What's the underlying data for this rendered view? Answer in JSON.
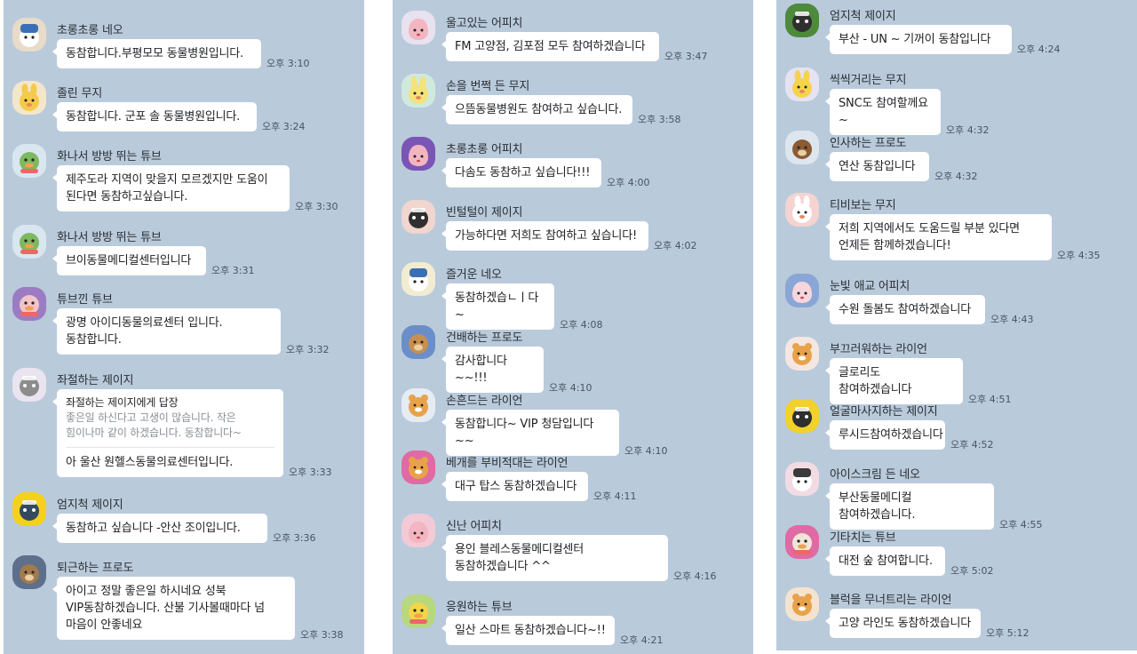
{
  "panels": [
    {
      "messages": [
        {
          "sender": "초롱초롱 네오",
          "text": "동참합니다.부평모모 동물병원입니다.",
          "time": "오후 3:10",
          "avatar": "neo-icon",
          "color": "#e8dbc7",
          "face": "#3b6fb5"
        },
        {
          "sender": "졸린 무지",
          "text": "동참합니다. 군포 솔 동물병원입니다.",
          "time": "오후 3:24",
          "avatar": "muzi-icon",
          "color": "#f3e7c9",
          "face": "#f5c94a"
        },
        {
          "sender": "화나서 방방 뛰는 튜브",
          "text": "제주도라 지역이 맞을지 모르겠지만 도움이 된다면 동참하고싶습니다.",
          "time": "오후 3:30",
          "avatar": "tube-icon",
          "color": "#d9e6ef",
          "face": "#7db95e"
        },
        {
          "sender": "화나서 방방 뛰는 튜브",
          "text": "브이동물메디컬센터입니다",
          "time": "오후 3:31",
          "avatar": "tube-icon",
          "color": "#d9e6ef",
          "face": "#7db95e"
        },
        {
          "sender": "튜브낀 튜브",
          "text": "광명 아이디동물의료센터 입니다. 동참합니다.",
          "time": "오후 3:32",
          "avatar": "tube-icon",
          "color": "#9b7cc2",
          "face": "#f2c3c9"
        },
        {
          "sender": "좌절하는 제이지",
          "reply_to": "좌절하는 제이지에게 답장",
          "quote": "좋은일 하신다고 고생이 많습니다. 작은 힘이나마 같이 하겠습니다. 동참합니다~",
          "text": "아 울산 원헬스동물의료센터입니다.",
          "time": "오후 3:33",
          "avatar": "jayg-icon",
          "color": "#e9e4ef",
          "face": "#8c8c8c"
        },
        {
          "sender": "엄지척 제이지",
          "text": "동참하고 싶습니다 -안산 조이입니다.",
          "time": "오후 3:36",
          "avatar": "jayg-icon",
          "color": "#f4d11c",
          "face": "#34495e"
        },
        {
          "sender": "퇴근하는 프로도",
          "text": "아이고 정말 좋은일 하시네요 성북 VIP동참하겠습니다. 산불 기사볼때마다 넘 마음이 안좋네요",
          "time": "오후 3:38",
          "avatar": "frodo-icon",
          "color": "#5d6f8a",
          "face": "#a37a4e"
        }
      ]
    },
    {
      "messages": [
        {
          "sender": "울고있는 어피치",
          "text": "FM 고양점, 김포점 모두 참여하겠습니다",
          "time": "오후 3:47",
          "avatar": "apeach-icon",
          "color": "#e8e1ef",
          "face": "#f3b6c1"
        },
        {
          "sender": "손을 번쩍 든 무지",
          "text": "으뜸동물병원도 참여하고 싶습니다.",
          "time": "오후 3:58",
          "avatar": "muzi-icon",
          "color": "#cfe9dc",
          "face": "#f4e27a"
        },
        {
          "sender": "초롱초롱 어피치",
          "text": "다솜도 동참하고 싶습니다!!!",
          "time": "오후 4:00",
          "avatar": "apeach-icon",
          "color": "#7a55b5",
          "face": "#f3b6c1"
        },
        {
          "sender": "빈털털이 제이지",
          "text": "가능하다면 저희도 참여하고 싶습니다!",
          "time": "오후 4:02",
          "avatar": "jayg-icon",
          "color": "#f1d5cf",
          "face": "#2f2f2f"
        },
        {
          "sender": "즐거운 네오",
          "text": "동참하겠습ㄴㅣ다~",
          "time": "오후 4:08",
          "avatar": "neo-icon",
          "color": "#f2ecd1",
          "face": "#3b6fb5"
        },
        {
          "sender": "건배하는 프로도",
          "text": "감사합니다~~!!!",
          "time": "오후 4:10",
          "avatar": "frodo-icon",
          "color": "#6a8ec9",
          "face": "#c98f4f"
        },
        {
          "sender": "손흔드는 라이언",
          "text": "동참합니다~ VIP 청담입니다~~",
          "time": "오후 4:10",
          "avatar": "ryan-icon",
          "color": "#e5ecf2",
          "face": "#e8a24a"
        },
        {
          "sender": "베개를 부비적대는 라이언",
          "text": "대구 탑스 동참하겠습니다",
          "time": "오후 4:11",
          "avatar": "ryan-icon",
          "color": "#e06aa3",
          "face": "#e8a24a"
        },
        {
          "sender": "신난 어피치",
          "text": "용인 블레스동물메디컬센터 동참하겠습니다 ^^",
          "time": "오후 4:16",
          "avatar": "apeach-icon",
          "color": "#f3c9d6",
          "face": "#f3b6c1"
        },
        {
          "sender": "응원하는 튜브",
          "text": "일산 스마트 동참하겠습니다~!!",
          "time": "오후 4:21",
          "avatar": "tube-icon",
          "color": "#b7d87d",
          "face": "#f3d54b"
        }
      ]
    },
    {
      "messages": [
        {
          "sender": "엄지척 제이지",
          "text": "부산 - UN ~ 기꺼이 동참입니다",
          "time": "오후 4:24",
          "avatar": "jayg-icon",
          "color": "#4d8a3c",
          "face": "#2f2f2f"
        },
        {
          "sender": "씩씩거리는 무지",
          "text": "SNC도 참여할께요~",
          "time": "오후 4:32",
          "avatar": "muzi-icon",
          "color": "#e6e2f1",
          "face": "#f5d34b"
        },
        {
          "sender": "인사하는 프로도",
          "text": "연산 동참입니다",
          "time": "오후 4:32",
          "avatar": "frodo-icon",
          "color": "#dde6ee",
          "face": "#8a5b34"
        },
        {
          "sender": "티비보는 무지",
          "text": "저희 지역에서도 도움드릴 부분 있다면 언제든 함께하겠습니다!",
          "time": "오후 4:35",
          "avatar": "muzi-icon",
          "color": "#f4d3d0",
          "face": "#ffffff"
        },
        {
          "sender": "눈빛 애교 어피치",
          "text": "수원 돌봄도 참여하겠습니다",
          "time": "오후 4:43",
          "avatar": "apeach-icon",
          "color": "#8aa6d6",
          "face": "#f6d6dd"
        },
        {
          "sender": "부끄러워하는 라이언",
          "text": "글로리도 참여하겠습니다",
          "time": "오후 4:51",
          "avatar": "ryan-icon",
          "color": "#f4e6e1",
          "face": "#e8a24a"
        },
        {
          "sender": "얼굴마사지하는 제이지",
          "text": "루시드참여하겠습니다",
          "time": "오후 4:52",
          "avatar": "jayg-icon",
          "color": "#f1d12a",
          "face": "#2f2f2f"
        },
        {
          "sender": "아이스크림 든 네오",
          "text": "부산동물메디컬 참여하겠습니다.",
          "time": "오후 4:55",
          "avatar": "neo-icon",
          "color": "#f3dbe3",
          "face": "#3a3a3a"
        },
        {
          "sender": "기타치는 튜브",
          "text": "대전 숲 참여합니다.",
          "time": "오후 5:02",
          "avatar": "tube-icon",
          "color": "#e06aa3",
          "face": "#efe6d9"
        },
        {
          "sender": "블럭을 무너트리는 라이언",
          "text": "고양 라인도 동참하겠습니다",
          "time": "오후 5:12",
          "avatar": "ryan-icon",
          "color": "#f3e3cf",
          "face": "#e8a24a"
        }
      ]
    }
  ]
}
